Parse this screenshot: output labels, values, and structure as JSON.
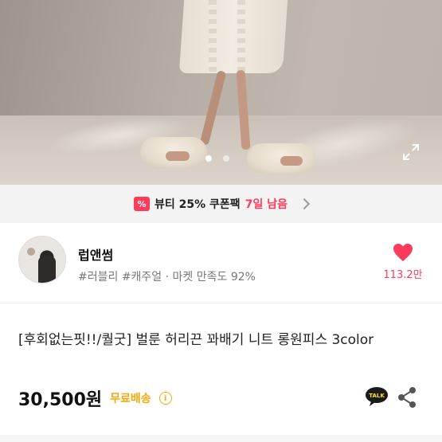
{
  "coupon": {
    "icon": "coupon-icon",
    "icon_glyph": "%",
    "label": "뷰티 25% 쿠폰팩",
    "days_left": "7일 남음"
  },
  "gallery": {
    "slide_count": 2,
    "active_slide": 1
  },
  "shop": {
    "name": "럽앤썸",
    "tags": "#러블리 #캐주얼 · 마켓 만족도 92%",
    "like_count": "113.2만"
  },
  "product": {
    "title": "[후회없는핏!!/퀄굿] 벌룬 허리끈 꽈배기 니트 롱원피스 3color",
    "price": "30,500원",
    "shipping": "무료배송",
    "info_glyph": "i"
  },
  "actions": {
    "talk_label": "TALK"
  },
  "colors": {
    "accent": "#ff3b5c",
    "shipping": "#f6a90d"
  }
}
